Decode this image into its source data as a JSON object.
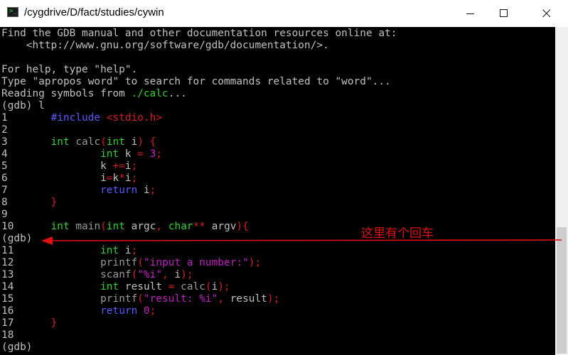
{
  "window": {
    "title": "/cygdrive/D/fact/studies/cywin",
    "icon": "terminal-icon",
    "icon_prompt": ">_",
    "controls": [
      "minimize-icon",
      "maximize-icon",
      "close-icon"
    ]
  },
  "terminal": {
    "lines": [
      [
        {
          "t": "Find the GDB manual and other documentation resources online at:"
        }
      ],
      [
        {
          "t": "    <http://www.gnu.org/software/gdb/documentation/>."
        }
      ],
      [
        {
          "t": ""
        }
      ],
      [
        {
          "t": "For help, type \"help\"."
        }
      ],
      [
        {
          "t": "Type \"apropos word\" to search for commands related to \"word\"..."
        }
      ],
      [
        {
          "t": "Reading symbols from "
        },
        {
          "t": "./calc",
          "c": "green"
        },
        {
          "t": "..."
        }
      ],
      [
        {
          "t": "(gdb) l"
        }
      ],
      [
        {
          "t": "1       "
        },
        {
          "t": "#include",
          "c": "blue"
        },
        {
          "t": " "
        },
        {
          "t": "<stdio.h>",
          "c": "red"
        }
      ],
      [
        {
          "t": "2"
        }
      ],
      [
        {
          "t": "3       "
        },
        {
          "t": "int",
          "c": "green"
        },
        {
          "t": " "
        },
        {
          "t": "calc",
          "c": "gray"
        },
        {
          "t": "(",
          "c": "red"
        },
        {
          "t": "int",
          "c": "green"
        },
        {
          "t": " i"
        },
        {
          "t": ") {",
          "c": "red"
        }
      ],
      [
        {
          "t": "4               "
        },
        {
          "t": "int",
          "c": "green"
        },
        {
          "t": " k "
        },
        {
          "t": "=",
          "c": "red"
        },
        {
          "t": " "
        },
        {
          "t": "3",
          "c": "magenta"
        },
        {
          "t": ";",
          "c": "red"
        }
      ],
      [
        {
          "t": "5               k "
        },
        {
          "t": "+=",
          "c": "red"
        },
        {
          "t": "i"
        },
        {
          "t": ";",
          "c": "red"
        }
      ],
      [
        {
          "t": "6               i"
        },
        {
          "t": "=",
          "c": "red"
        },
        {
          "t": "k"
        },
        {
          "t": "*",
          "c": "red"
        },
        {
          "t": "i"
        },
        {
          "t": ";",
          "c": "red"
        }
      ],
      [
        {
          "t": "7               "
        },
        {
          "t": "return",
          "c": "blue"
        },
        {
          "t": " i"
        },
        {
          "t": ";",
          "c": "red"
        }
      ],
      [
        {
          "t": "8       "
        },
        {
          "t": "}",
          "c": "red"
        }
      ],
      [
        {
          "t": "9"
        }
      ],
      [
        {
          "t": "10      "
        },
        {
          "t": "int",
          "c": "green"
        },
        {
          "t": " "
        },
        {
          "t": "main",
          "c": "gray"
        },
        {
          "t": "(",
          "c": "red"
        },
        {
          "t": "int",
          "c": "green"
        },
        {
          "t": " argc"
        },
        {
          "t": ",",
          "c": "red"
        },
        {
          "t": " "
        },
        {
          "t": "char",
          "c": "green"
        },
        {
          "t": "**",
          "c": "red"
        },
        {
          "t": " argv"
        },
        {
          "t": "){",
          "c": "red"
        }
      ],
      [
        {
          "t": "(gdb)"
        }
      ],
      [
        {
          "t": "11              "
        },
        {
          "t": "int",
          "c": "green"
        },
        {
          "t": " i"
        },
        {
          "t": ";",
          "c": "red"
        }
      ],
      [
        {
          "t": "12              "
        },
        {
          "t": "printf",
          "c": "gray"
        },
        {
          "t": "(",
          "c": "red"
        },
        {
          "t": "\"input a number:\"",
          "c": "magenta"
        },
        {
          "t": ");",
          "c": "red"
        }
      ],
      [
        {
          "t": "13              "
        },
        {
          "t": "scanf",
          "c": "gray"
        },
        {
          "t": "(",
          "c": "red"
        },
        {
          "t": "\"%i\"",
          "c": "magenta"
        },
        {
          "t": ",",
          "c": "red"
        },
        {
          "t": " i"
        },
        {
          "t": ");",
          "c": "red"
        }
      ],
      [
        {
          "t": "14              "
        },
        {
          "t": "int",
          "c": "green"
        },
        {
          "t": " result "
        },
        {
          "t": "=",
          "c": "red"
        },
        {
          "t": " "
        },
        {
          "t": "calc",
          "c": "gray"
        },
        {
          "t": "(",
          "c": "red"
        },
        {
          "t": "i"
        },
        {
          "t": ");",
          "c": "red"
        }
      ],
      [
        {
          "t": "15              "
        },
        {
          "t": "printf",
          "c": "gray"
        },
        {
          "t": "(",
          "c": "red"
        },
        {
          "t": "\"result: %i\"",
          "c": "magenta"
        },
        {
          "t": ",",
          "c": "red"
        },
        {
          "t": " result"
        },
        {
          "t": ");",
          "c": "red"
        }
      ],
      [
        {
          "t": "16              "
        },
        {
          "t": "return",
          "c": "blue"
        },
        {
          "t": " "
        },
        {
          "t": "0",
          "c": "magenta"
        },
        {
          "t": ";",
          "c": "red"
        }
      ],
      [
        {
          "t": "17      "
        },
        {
          "t": "}",
          "c": "red"
        }
      ],
      [
        {
          "t": "18"
        }
      ],
      [
        {
          "t": "(gdb)"
        }
      ]
    ]
  },
  "annotation": {
    "text": "这里有个回车",
    "color": "#e01010"
  },
  "colors": {
    "default": "#c0c0c0",
    "blue": "#5a5aff",
    "red": "#d81e1e",
    "green": "#2fd12f",
    "orange": "#c85014",
    "magenta": "#c020c0",
    "gray": "#9a9a9a",
    "background": "#000000"
  }
}
